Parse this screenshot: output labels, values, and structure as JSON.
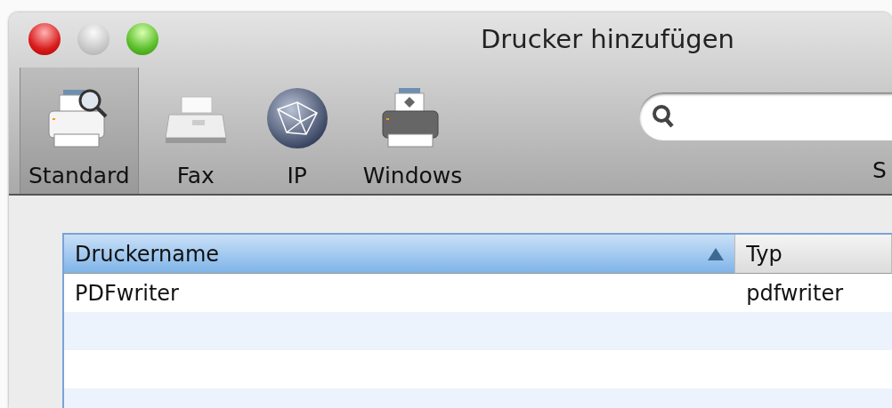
{
  "window": {
    "title": "Drucker hinzufügen"
  },
  "toolbar": {
    "items": [
      {
        "kind": "local",
        "label": "Standard",
        "selected": true
      },
      {
        "kind": "fax",
        "label": "Fax",
        "selected": false
      },
      {
        "kind": "ip",
        "label": "IP",
        "selected": false
      },
      {
        "kind": "windows",
        "label": "Windows",
        "selected": false
      }
    ],
    "search_label": "S"
  },
  "table": {
    "columns": [
      {
        "label": "Druckername",
        "sorted": true
      },
      {
        "label": "Typ",
        "sorted": false
      }
    ],
    "rows": [
      [
        "PDFwriter",
        "pdfwriter"
      ]
    ]
  }
}
